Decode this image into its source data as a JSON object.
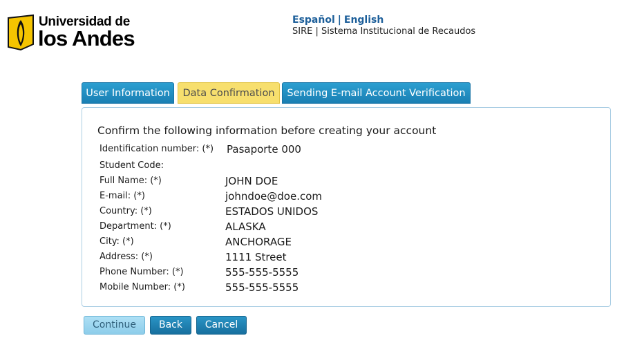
{
  "logo": {
    "line1": "Universidad de",
    "line2": "los Andes"
  },
  "header": {
    "lang_es": "Español",
    "lang_sep": "|",
    "lang_en": "English",
    "system_title": "SIRE | Sistema Institucional de Recaudos"
  },
  "tabs": [
    {
      "label": "User Information",
      "active": false
    },
    {
      "label": "Data Confirmation",
      "active": true
    },
    {
      "label": "Sending E-mail Account Verification",
      "active": false
    }
  ],
  "panel": {
    "title": "Confirm the following information before creating your account",
    "fields": [
      {
        "label": "Identification number: (*)",
        "value": "Pasaporte 000"
      },
      {
        "label": "Student Code:",
        "value": ""
      },
      {
        "label": "Full Name: (*)",
        "value": "JOHN DOE"
      },
      {
        "label": "E-mail: (*)",
        "value": "johndoe@doe.com"
      },
      {
        "label": "Country: (*)",
        "value": "ESTADOS UNIDOS"
      },
      {
        "label": "Department: (*)",
        "value": "ALASKA"
      },
      {
        "label": "City: (*)",
        "value": "ANCHORAGE"
      },
      {
        "label": "Address: (*)",
        "value": "1111 Street"
      },
      {
        "label": "Phone Number: (*)",
        "value": "555-555-5555"
      },
      {
        "label": "Mobile Number: (*)",
        "value": "555-555-5555"
      }
    ]
  },
  "buttons": {
    "continue": "Continue",
    "back": "Back",
    "cancel": "Cancel"
  },
  "colors": {
    "tab_blue": "#1a7fb3",
    "tab_active": "#f7df6e",
    "link_blue": "#1d5f9a",
    "logo_yellow": "#f5c400"
  }
}
